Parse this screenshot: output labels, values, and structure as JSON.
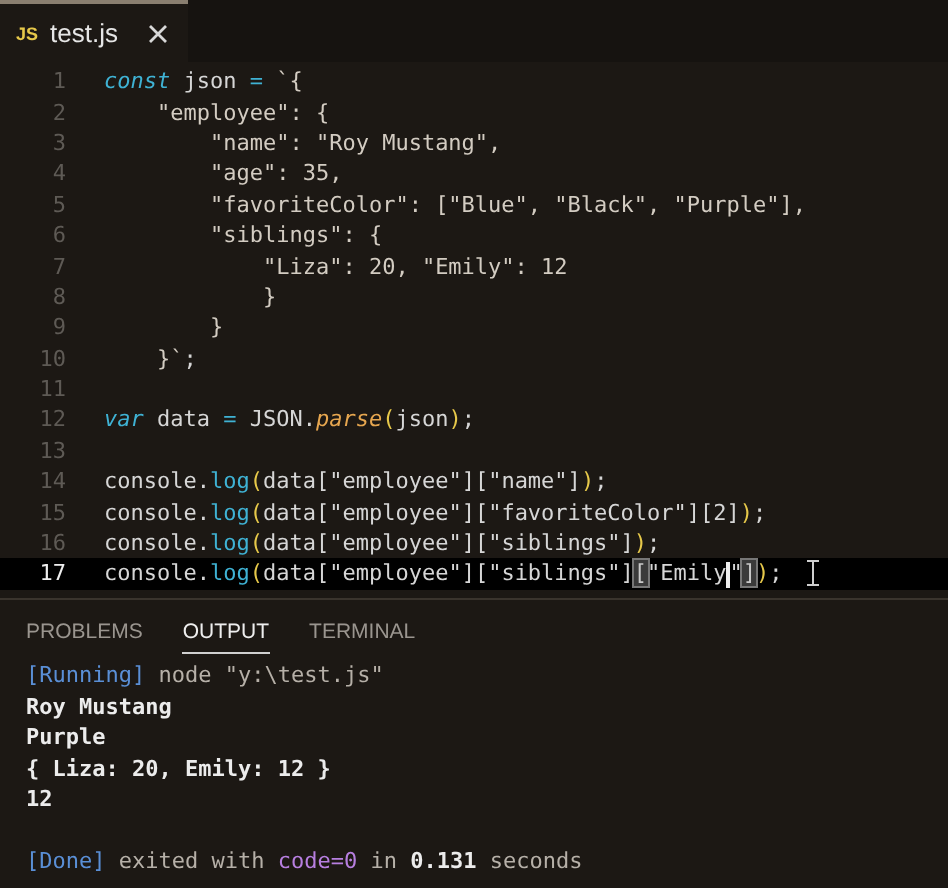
{
  "editor_tabs": [
    {
      "badge": "JS",
      "label": "test.js",
      "selected": true
    }
  ],
  "code_lines": [
    {
      "number": "1",
      "current": false,
      "tokens": [
        {
          "kind": "keyword",
          "text": "const"
        },
        {
          "kind": "plain",
          "text": " json "
        },
        {
          "kind": "operator",
          "text": "="
        },
        {
          "kind": "string",
          "text": " `{"
        }
      ]
    },
    {
      "number": "2",
      "current": false,
      "tokens": [
        {
          "kind": "string",
          "text": "    \"employee\": {"
        }
      ]
    },
    {
      "number": "3",
      "current": false,
      "tokens": [
        {
          "kind": "string",
          "text": "        \"name\": \"Roy Mustang\","
        }
      ]
    },
    {
      "number": "4",
      "current": false,
      "tokens": [
        {
          "kind": "string",
          "text": "        \"age\": 35,"
        }
      ]
    },
    {
      "number": "5",
      "current": false,
      "tokens": [
        {
          "kind": "string",
          "text": "        \"favoriteColor\": [\"Blue\", \"Black\", \"Purple\"],"
        }
      ]
    },
    {
      "number": "6",
      "current": false,
      "tokens": [
        {
          "kind": "string",
          "text": "        \"siblings\": {"
        }
      ]
    },
    {
      "number": "7",
      "current": false,
      "tokens": [
        {
          "kind": "string",
          "text": "            \"Liza\": 20, \"Emily\": 12"
        }
      ]
    },
    {
      "number": "8",
      "current": false,
      "tokens": [
        {
          "kind": "string",
          "text": "            }"
        }
      ]
    },
    {
      "number": "9",
      "current": false,
      "tokens": [
        {
          "kind": "string",
          "text": "        }"
        }
      ]
    },
    {
      "number": "10",
      "current": false,
      "tokens": [
        {
          "kind": "string",
          "text": "    }`"
        },
        {
          "kind": "plain",
          "text": ";"
        }
      ]
    },
    {
      "number": "11",
      "current": false
    },
    {
      "number": "12",
      "current": false,
      "tokens": [
        {
          "kind": "keyword",
          "text": "var"
        },
        {
          "kind": "plain",
          "text": " data "
        },
        {
          "kind": "operator",
          "text": "="
        },
        {
          "kind": "plain",
          "text": " JSON."
        },
        {
          "kind": "function",
          "text": "parse"
        },
        {
          "kind": "paren",
          "text": "("
        },
        {
          "kind": "plain",
          "text": "json"
        },
        {
          "kind": "paren",
          "text": ")"
        },
        {
          "kind": "plain",
          "text": ";"
        }
      ]
    },
    {
      "number": "13",
      "current": false
    },
    {
      "number": "14",
      "current": false,
      "tokens": [
        {
          "kind": "plain",
          "text": "console."
        },
        {
          "kind": "method",
          "text": "log"
        },
        {
          "kind": "paren",
          "text": "("
        },
        {
          "kind": "plain",
          "text": "data[\"employee\"][\"name\"]"
        },
        {
          "kind": "paren",
          "text": ")"
        },
        {
          "kind": "plain",
          "text": ";"
        }
      ]
    },
    {
      "number": "15",
      "current": false,
      "tokens": [
        {
          "kind": "plain",
          "text": "console."
        },
        {
          "kind": "method",
          "text": "log"
        },
        {
          "kind": "paren",
          "text": "("
        },
        {
          "kind": "plain",
          "text": "data[\"employee\"][\"favoriteColor\"][2]"
        },
        {
          "kind": "paren",
          "text": ")"
        },
        {
          "kind": "plain",
          "text": ";"
        }
      ]
    },
    {
      "number": "16",
      "current": false,
      "tokens": [
        {
          "kind": "plain",
          "text": "console."
        },
        {
          "kind": "method",
          "text": "log"
        },
        {
          "kind": "paren",
          "text": "("
        },
        {
          "kind": "plain",
          "text": "data[\"employee\"][\"siblings\"]"
        },
        {
          "kind": "paren",
          "text": ")"
        },
        {
          "kind": "plain",
          "text": ";"
        }
      ]
    },
    {
      "number": "17",
      "current": true,
      "tokens": [
        {
          "kind": "plain",
          "text": "console."
        },
        {
          "kind": "method",
          "text": "log"
        },
        {
          "kind": "paren",
          "text": "("
        },
        {
          "kind": "plain",
          "text": "data[\"employee\"][\"siblings\"]"
        },
        {
          "kind": "bracket-match",
          "text": "["
        },
        {
          "kind": "plain",
          "text": "\"Emily",
          "cursor_after": true
        },
        {
          "kind": "plain",
          "text": "\""
        },
        {
          "kind": "bracket-match",
          "text": "]"
        },
        {
          "kind": "paren",
          "text": ")"
        },
        {
          "kind": "plain",
          "text": ";"
        }
      ]
    }
  ],
  "panel_tabs": [
    {
      "label": "PROBLEMS",
      "selected": false
    },
    {
      "label": "OUTPUT",
      "selected": true
    },
    {
      "label": "TERMINAL",
      "selected": false
    }
  ],
  "output_lines": [
    [
      {
        "kind": "tag",
        "text": "[Running]"
      },
      {
        "kind": "dim",
        "text": " node \"y:\\test.js\""
      }
    ],
    [
      {
        "kind": "result",
        "text": "Roy Mustang"
      }
    ],
    [
      {
        "kind": "result",
        "text": "Purple"
      }
    ],
    [
      {
        "kind": "result",
        "text": "{ Liza: 20, Emily: 12 }"
      }
    ],
    [
      {
        "kind": "result",
        "text": "12"
      }
    ]
  ],
  "done_line": [
    {
      "kind": "tag",
      "text": "[Done]"
    },
    {
      "kind": "dim",
      "text": " exited with "
    },
    {
      "kind": "code",
      "text": "code=0"
    },
    {
      "kind": "dim",
      "text": " in "
    },
    {
      "kind": "result",
      "text": "0.131"
    },
    {
      "kind": "dim",
      "text": " seconds"
    }
  ]
}
